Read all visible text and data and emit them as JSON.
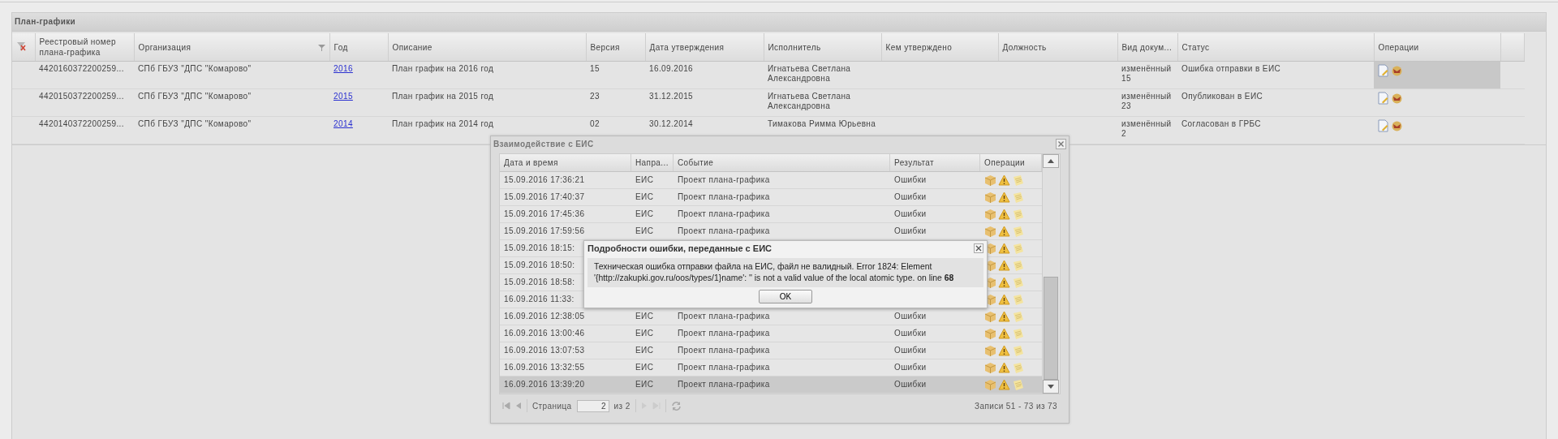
{
  "panel": {
    "title": "План-графики"
  },
  "table": {
    "columns": [
      {
        "label": "Реестровый номер плана-графика"
      },
      {
        "label": "Организация",
        "filter": true
      },
      {
        "label": "Год"
      },
      {
        "label": "Описание"
      },
      {
        "label": "Версия"
      },
      {
        "label": "Дата утверждения"
      },
      {
        "label": "Исполнитель"
      },
      {
        "label": "Кем утверждено"
      },
      {
        "label": "Должность"
      },
      {
        "label": "Вид докум..."
      },
      {
        "label": "Статус"
      },
      {
        "label": "Операции"
      }
    ],
    "rows": [
      {
        "number": "4420160372200259...",
        "organization": "СПб ГБУЗ \"ДПС \"Комарово\"",
        "year": "2016",
        "description": "План график на 2016 год",
        "version": "15",
        "date": "16.09.2016",
        "executor": "Игнатьева Светлана Александровна",
        "doc_type": "изменённый 15",
        "status": "Ошибка отправки в ЕИС",
        "selected": true
      },
      {
        "number": "4420150372200259...",
        "organization": "СПб ГБУЗ \"ДПС \"Комарово\"",
        "year": "2015",
        "description": "План график на 2015 год",
        "version": "23",
        "date": "31.12.2015",
        "executor": "Игнатьева Светлана Александровна",
        "doc_type": "изменённый 23",
        "status": "Опубликован в ЕИС",
        "selected": false
      },
      {
        "number": "4420140372200259...",
        "organization": "СПб ГБУЗ \"ДПС \"Комарово\"",
        "year": "2014",
        "description": "План график на 2014 год",
        "version": "02",
        "date": "30.12.2014",
        "executor": "Тимакова Римма Юрьевна",
        "doc_type": "изменённый 2",
        "status": "Согласован в ГРБС",
        "selected": false
      }
    ]
  },
  "dialog": {
    "title": "Взаимодействие с ЕИС",
    "columns": [
      {
        "label": "Дата и время"
      },
      {
        "label": "Напра..."
      },
      {
        "label": "Событие"
      },
      {
        "label": "Результат"
      },
      {
        "label": "Операции"
      }
    ],
    "rows": [
      {
        "date": "15.09.2016 17:36:21",
        "direction": "ЕИС",
        "event": "Проект плана-графика",
        "result": "Ошибки",
        "selected": false
      },
      {
        "date": "15.09.2016 17:40:37",
        "direction": "ЕИС",
        "event": "Проект плана-графика",
        "result": "Ошибки",
        "selected": false
      },
      {
        "date": "15.09.2016 17:45:36",
        "direction": "ЕИС",
        "event": "Проект плана-графика",
        "result": "Ошибки",
        "selected": false
      },
      {
        "date": "15.09.2016 17:59:56",
        "direction": "ЕИС",
        "event": "Проект плана-графика",
        "result": "Ошибки",
        "selected": false
      },
      {
        "date": "15.09.2016 18:15:",
        "selected": false
      },
      {
        "date": "15.09.2016 18:50:",
        "selected": false
      },
      {
        "date": "15.09.2016 18:58:",
        "selected": false
      },
      {
        "date": "16.09.2016 11:33:",
        "selected": false
      },
      {
        "date": "16.09.2016 12:38:05",
        "direction": "ЕИС",
        "event": "Проект плана-графика",
        "result": "Ошибки",
        "selected": false
      },
      {
        "date": "16.09.2016 13:00:46",
        "direction": "ЕИС",
        "event": "Проект плана-графика",
        "result": "Ошибки",
        "selected": false
      },
      {
        "date": "16.09.2016 13:07:53",
        "direction": "ЕИС",
        "event": "Проект плана-графика",
        "result": "Ошибки",
        "selected": false
      },
      {
        "date": "16.09.2016 13:32:55",
        "direction": "ЕИС",
        "event": "Проект плана-графика",
        "result": "Ошибки",
        "selected": false
      },
      {
        "date": "16.09.2016 13:39:20",
        "direction": "ЕИС",
        "event": "Проект плана-графика",
        "result": "Ошибки",
        "selected": true
      }
    ],
    "pager": {
      "page_label": "Страница",
      "page": "2",
      "of": "из 2",
      "summary": "Записи 51 - 73 из 73"
    }
  },
  "error_popup": {
    "title": "Подробности ошибки, переданные с ЕИС",
    "message": "Техническая ошибка отправки файла на ЕИС, файл не валидный. Error 1824: Element '{http://zakupki.gov.ru/oos/types/1}name': '' is not a valid value of the local atomic type. on line **68**",
    "button": "OK"
  }
}
